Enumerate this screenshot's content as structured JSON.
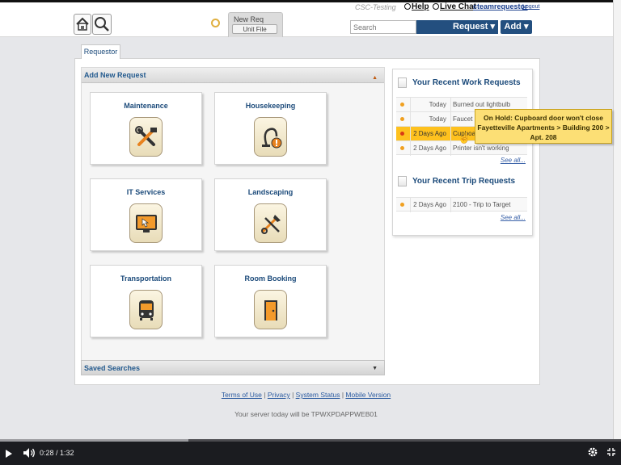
{
  "header": {
    "new_req_label": "New Req",
    "unit_file_label": "Unit File",
    "env_label": "CSC-Testing",
    "help_label": "Help",
    "live_chat_label": "Live Chat",
    "username": "cteamrequestor",
    "logout_label": "Logout",
    "search_placeholder": "Search",
    "request_dropdown": "Request ▾",
    "add_dropdown": "Add ▾"
  },
  "main": {
    "tab_label": "Requestor",
    "add_new_header": "Add New Request",
    "tiles": [
      {
        "label": "Maintenance",
        "icon": "wrench-hammer-icon"
      },
      {
        "label": "Housekeeping",
        "icon": "vacuum-icon"
      },
      {
        "label": "IT Services",
        "icon": "monitor-icon"
      },
      {
        "label": "Landscaping",
        "icon": "shovel-rake-icon"
      },
      {
        "label": "Transportation",
        "icon": "bus-icon"
      },
      {
        "label": "Room Booking",
        "icon": "door-icon"
      }
    ],
    "saved_searches_label": "Saved Searches"
  },
  "recent": {
    "work_heading": "Your Recent Work Requests",
    "work_rows": [
      {
        "date": "Today",
        "desc": "Burned out lightbulb",
        "status_color": "#f0a020"
      },
      {
        "date": "Today",
        "desc": "Faucet isn't",
        "status_color": "#f0a020"
      },
      {
        "date": "2 Days Ago",
        "desc": "Cupboard",
        "status_color": "#d93a16"
      },
      {
        "date": "2 Days Ago",
        "desc": "Printer isn't working",
        "status_color": "#f0a020"
      }
    ],
    "see_all_label": "See all...",
    "trip_heading": "Your Recent Trip Requests",
    "trip_rows": [
      {
        "date": "2 Days Ago",
        "desc": "2100 - Trip to Target",
        "status_color": "#f0a020"
      }
    ],
    "tooltip_line1": "On Hold: Cupboard door won't close",
    "tooltip_line2": "Fayetteville Apartments > Building 200 >",
    "tooltip_line3": "Apt. 208"
  },
  "footer": {
    "terms_label": "Terms of Use",
    "privacy_label": "Privacy",
    "system_status_label": "System Status",
    "mobile_label": "Mobile Version",
    "server_text": "Your server today will be TPWXPDAPPWEB01"
  },
  "video": {
    "time_text": "0:28 / 1:32",
    "progress": 0.304
  },
  "colors": {
    "brand_blue": "#234f7f",
    "highlight_orange": "#fec11e",
    "tooltip_yellow": "#fcdf75"
  }
}
